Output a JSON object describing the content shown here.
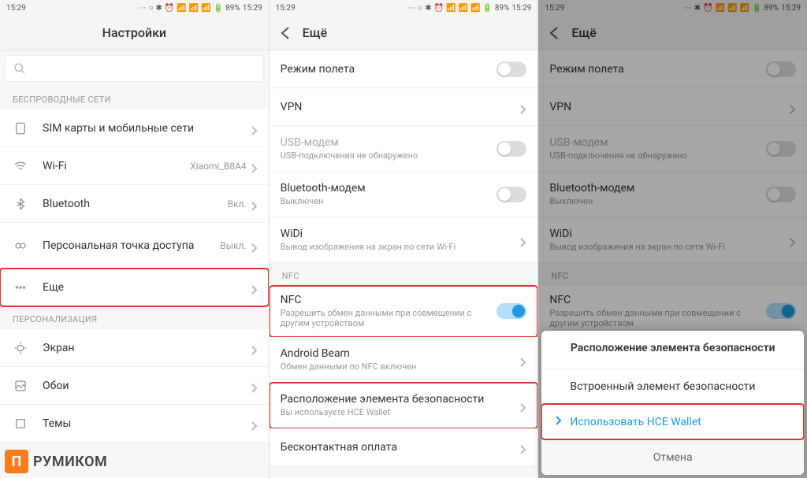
{
  "status": {
    "time": "15:29",
    "battery": "89%"
  },
  "pane1": {
    "title": "Настройки",
    "sect_wireless": "БЕСПРОВОДНЫЕ СЕТИ",
    "sect_personal": "ПЕРСОНАЛИЗАЦИЯ",
    "sim": "SIM карты и мобильные сети",
    "wifi": "Wi-Fi",
    "wifi_val": "Xiaomi_B8A4",
    "bt": "Bluetooth",
    "bt_val": "Вкл.",
    "hotspot": "Персональная точка доступа",
    "hotspot_val": "Выкл.",
    "more": "Еще",
    "display": "Экран",
    "wallpaper": "Обои",
    "themes": "Темы"
  },
  "pane2": {
    "title": "Ещё",
    "airplane": "Режим полета",
    "vpn": "VPN",
    "usb": "USB-модем",
    "usb_sub": "USB-подключения не обнаружено",
    "btm": "Bluetooth-модем",
    "btm_sub": "Выключен",
    "widi": "WiDi",
    "widi_sub": "Вывод изображения на экран по сети Wi-Fi",
    "sect_nfc": "NFC",
    "nfc": "NFC",
    "nfc_sub": "Разрешить обмен данными при совмещении с другим устройством",
    "beam": "Android Beam",
    "beam_sub": "Обмен данными по NFC включен",
    "secelem": "Расположение элемента безопасности",
    "secelem_sub": "Вы используете HCE Wallet",
    "contactless": "Бесконтактная оплата"
  },
  "pane3": {
    "title": "Ещё",
    "airplane": "Режим полета",
    "vpn": "VPN",
    "usb": "USB-модем",
    "usb_sub": "USB-подключения не обнаружено",
    "btm": "Bluetooth-модем",
    "btm_sub": "Выключен",
    "widi": "WiDi",
    "widi_sub": "Вывод изображения на экран по сети Wi-Fi",
    "sect_nfc": "NFC",
    "nfc": "NFC",
    "nfc_sub": "Разрешить обмен данными при совмещении с другим устройством",
    "sheet_title": "Расположение элемента безопасности",
    "opt1": "Встроенный элемент безопасности",
    "opt2": "Использовать HCE Wallet",
    "cancel": "Отмена"
  },
  "logo": "РУМИКОМ"
}
